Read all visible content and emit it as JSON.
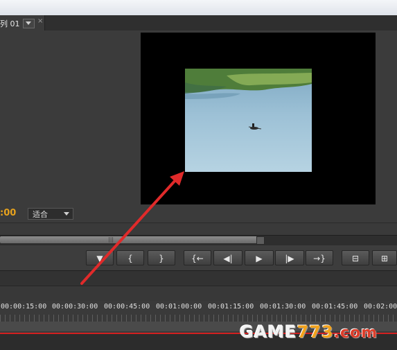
{
  "tab": {
    "label": "列 01",
    "close": "×"
  },
  "monitor": {
    "timecode": ":00",
    "fit_select": "适合"
  },
  "buttons": [
    {
      "name": "add-marker-button",
      "glyph": "▼"
    },
    {
      "name": "mark-in-button",
      "glyph": "{"
    },
    {
      "name": "mark-out-button",
      "glyph": "}"
    },
    {
      "name": "go-to-in-button",
      "glyph": "{←"
    },
    {
      "name": "step-back-button",
      "glyph": "◀|"
    },
    {
      "name": "play-button",
      "glyph": "▶"
    },
    {
      "name": "step-forward-button",
      "glyph": "|▶"
    },
    {
      "name": "go-to-out-button",
      "glyph": "→}"
    },
    {
      "name": "lift-button",
      "glyph": "⊟"
    },
    {
      "name": "extract-button",
      "glyph": "⊞"
    }
  ],
  "timeline": {
    "ticks": [
      "00:00:15:00",
      "00:00:30:00",
      "00:00:45:00",
      "00:01:00:00",
      "00:01:15:00",
      "00:01:30:00",
      "00:01:45:00",
      "00:02:00:"
    ]
  },
  "watermark": {
    "part1": "GAME",
    "part2": "773",
    "part3": ".com"
  },
  "colors": {
    "timecode": "#e7a21d",
    "annotation_arrow": "#e02a2a",
    "playhead": "#d32020"
  }
}
